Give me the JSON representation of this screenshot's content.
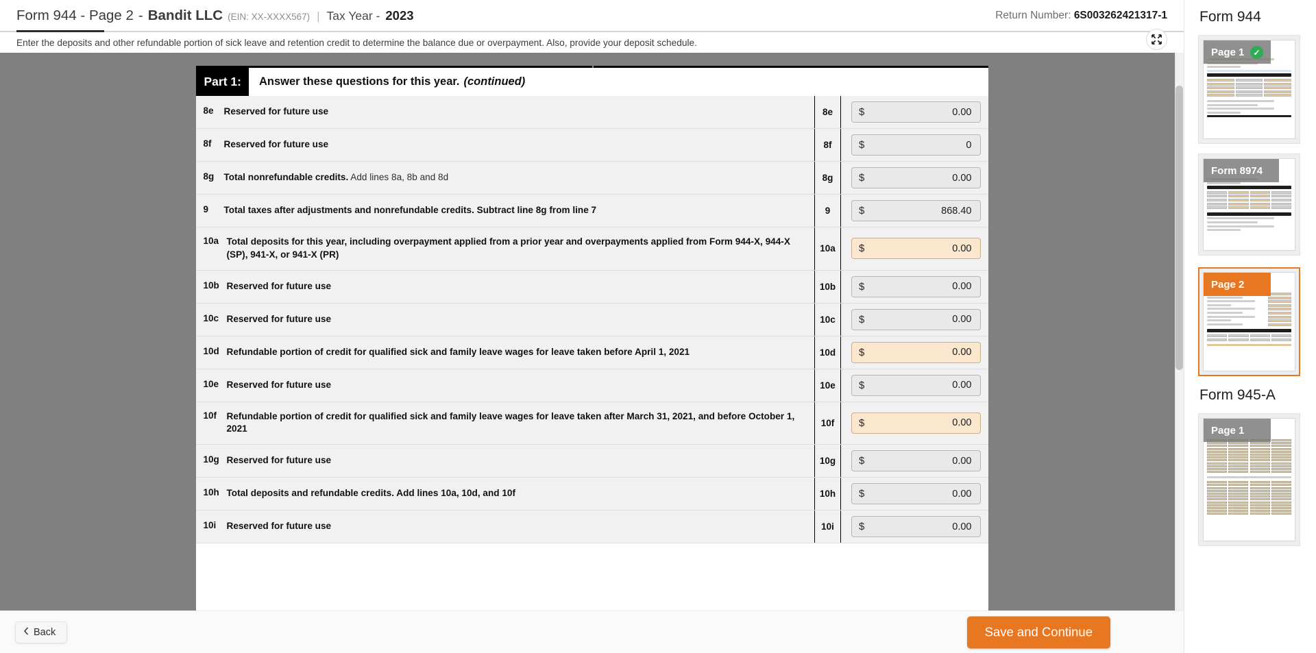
{
  "header": {
    "form_title": "Form 944 - Page 2",
    "dash": "-",
    "company": "Bandit LLC",
    "ein": "(EIN: XX-XXXX567)",
    "separator": "|",
    "tax_year_label": "Tax Year -",
    "tax_year_value": "2023",
    "return_number_label": "Return Number:",
    "return_number_value": "6S003262421317-1",
    "instruction": "Enter the deposits and other refundable portion of sick leave and retention credit to determine the balance due or overpayment. Also, provide your deposit schedule.",
    "expand_icon": "collapse-arrows-icon"
  },
  "part": {
    "tag": "Part 1:",
    "heading": "Answer these questions for this year.",
    "heading_italic": "(continued)"
  },
  "rows": [
    {
      "no": "8e",
      "desc_bold": "Reserved for future use",
      "desc_light": "",
      "value": "0.00",
      "currency": "$",
      "highlight": false
    },
    {
      "no": "8f",
      "desc_bold": "Reserved for future use",
      "desc_light": "",
      "value": "0",
      "currency": "$",
      "highlight": false
    },
    {
      "no": "8g",
      "desc_bold": "Total nonrefundable credits.",
      "desc_light": "Add lines 8a, 8b and 8d",
      "value": "0.00",
      "currency": "$",
      "highlight": false
    },
    {
      "no": "9",
      "desc_bold": "Total taxes after adjustments and nonrefundable credits. Subtract line 8g from line 7",
      "desc_light": "",
      "value": "868.40",
      "currency": "$",
      "highlight": false
    },
    {
      "no": "10a",
      "desc_bold": "Total deposits for this year, including overpayment applied from a prior year and overpayments applied from Form 944-X, 944-X (SP), 941-X, or 941-X (PR)",
      "desc_light": "",
      "value": "0.00",
      "currency": "$",
      "highlight": true
    },
    {
      "no": "10b",
      "desc_bold": "Reserved for future use",
      "desc_light": "",
      "value": "0.00",
      "currency": "$",
      "highlight": false
    },
    {
      "no": "10c",
      "desc_bold": "Reserved for future use",
      "desc_light": "",
      "value": "0.00",
      "currency": "$",
      "highlight": false
    },
    {
      "no": "10d",
      "desc_bold": "Refundable portion of credit for qualified sick and family leave wages for leave taken before April 1, 2021",
      "desc_light": "",
      "value": "0.00",
      "currency": "$",
      "highlight": true
    },
    {
      "no": "10e",
      "desc_bold": "Reserved for future use",
      "desc_light": "",
      "value": "0.00",
      "currency": "$",
      "highlight": false
    },
    {
      "no": "10f",
      "desc_bold": "Refundable portion of credit for qualified sick and family leave wages for leave taken after March 31, 2021, and before October 1, 2021",
      "desc_light": "",
      "value": "0.00",
      "currency": "$",
      "highlight": true
    },
    {
      "no": "10g",
      "desc_bold": "Reserved for future use",
      "desc_light": "",
      "value": "0.00",
      "currency": "$",
      "highlight": false
    },
    {
      "no": "10h",
      "desc_bold": "Total deposits and refundable credits. Add lines 10a, 10d, and 10f",
      "desc_light": "",
      "value": "0.00",
      "currency": "$",
      "highlight": false
    },
    {
      "no": "10i",
      "desc_bold": "Reserved for future use",
      "desc_light": "",
      "value": "0.00",
      "currency": "$",
      "highlight": false
    }
  ],
  "footer": {
    "back_label": "Back",
    "back_icon": "chevron-left-icon",
    "save_label": "Save and Continue",
    "accent_color": "#e87722"
  },
  "sidebar": {
    "groups": [
      {
        "title": "Form 944",
        "pages": [
          {
            "label": "Page 1",
            "completed": true,
            "active": false,
            "check_icon": "check-circle-icon"
          }
        ]
      },
      {
        "title": "",
        "pages": [
          {
            "label": "Form 8974",
            "completed": false,
            "active": false
          }
        ]
      },
      {
        "title": "",
        "pages": [
          {
            "label": "Page 2",
            "completed": false,
            "active": true
          }
        ]
      },
      {
        "title": "Form 945-A",
        "pages": [
          {
            "label": "Page 1",
            "completed": false,
            "active": false
          }
        ]
      }
    ]
  }
}
